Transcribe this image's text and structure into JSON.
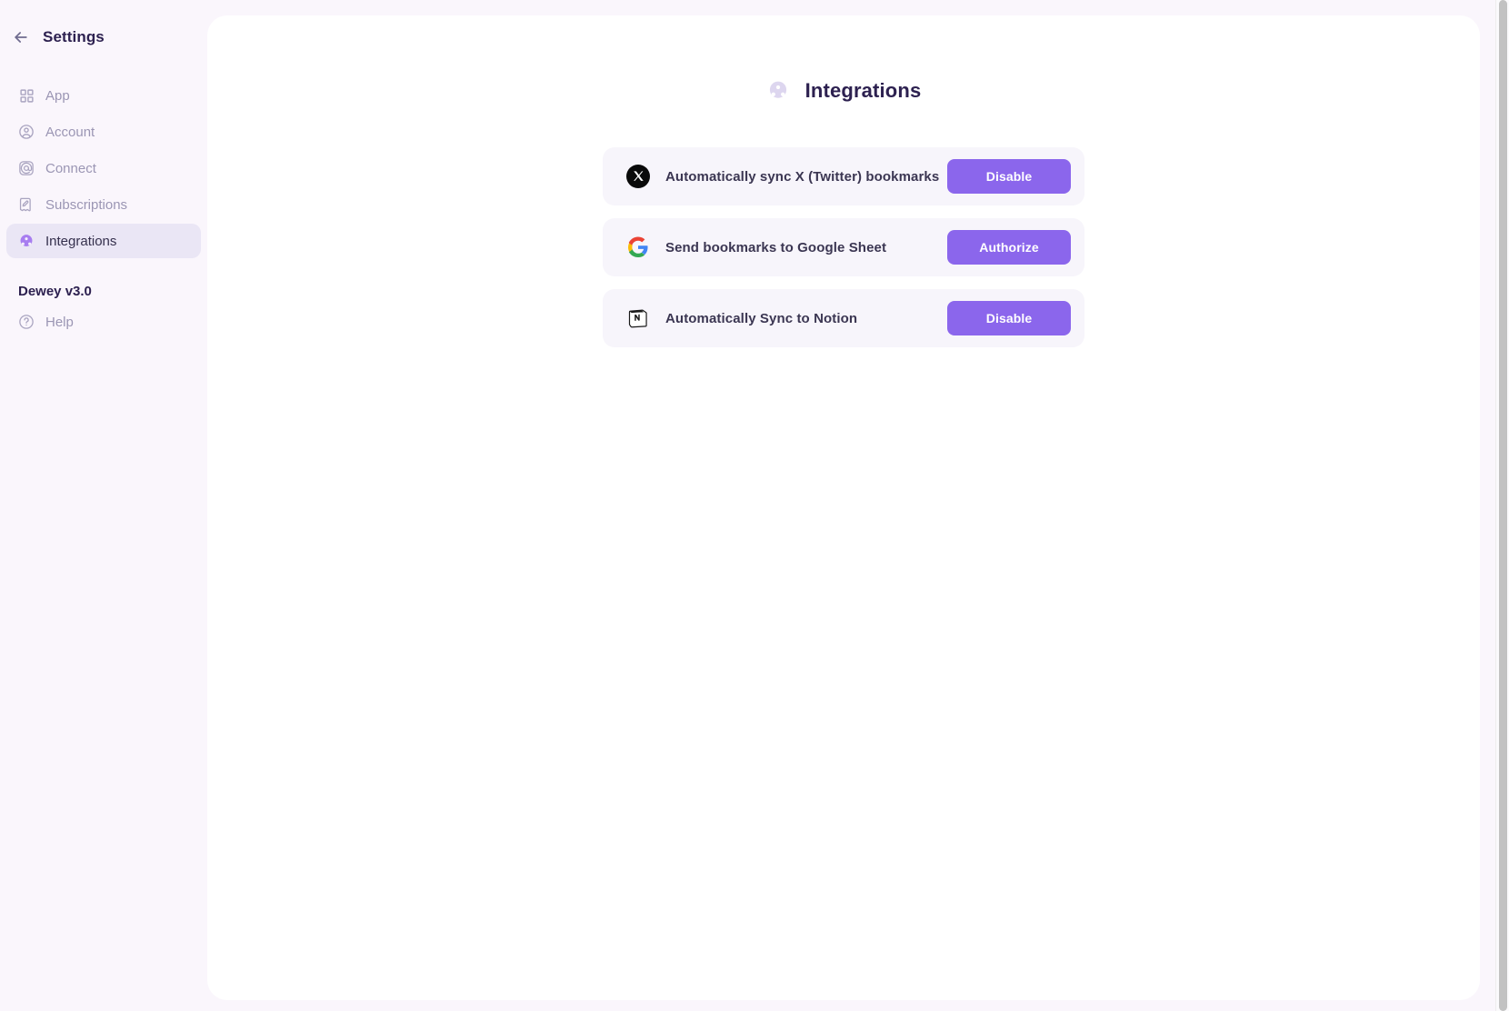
{
  "sidebar": {
    "back_icon": "arrow-left-icon",
    "title": "Settings",
    "items": [
      {
        "label": "App",
        "icon": "grid-icon",
        "active": false
      },
      {
        "label": "Account",
        "icon": "user-circle-icon",
        "active": false
      },
      {
        "label": "Connect",
        "icon": "at-sign-icon",
        "active": false
      },
      {
        "label": "Subscriptions",
        "icon": "receipt-edit-icon",
        "active": false
      },
      {
        "label": "Integrations",
        "icon": "puzzle-icon",
        "active": true
      }
    ],
    "version": "Dewey v3.0",
    "help": {
      "label": "Help",
      "icon": "question-circle-icon"
    }
  },
  "main": {
    "title": "Integrations",
    "title_icon": "puzzle-icon",
    "integrations": [
      {
        "icon": "x-twitter-icon",
        "label": "Automatically sync X (Twitter) bookmarks",
        "action": "Disable"
      },
      {
        "icon": "google-icon",
        "label": "Send bookmarks to Google Sheet",
        "action": "Authorize"
      },
      {
        "icon": "notion-icon",
        "label": "Automatically Sync to Notion",
        "action": "Disable"
      }
    ]
  },
  "colors": {
    "page_background": "#faf6fc",
    "panel_background": "#ffffff",
    "accent": "#8b66ec",
    "row_background": "#f7f5fb",
    "active_nav_background": "#eae6f5",
    "title_text": "#2d2150",
    "muted_text": "#9b96b4"
  }
}
